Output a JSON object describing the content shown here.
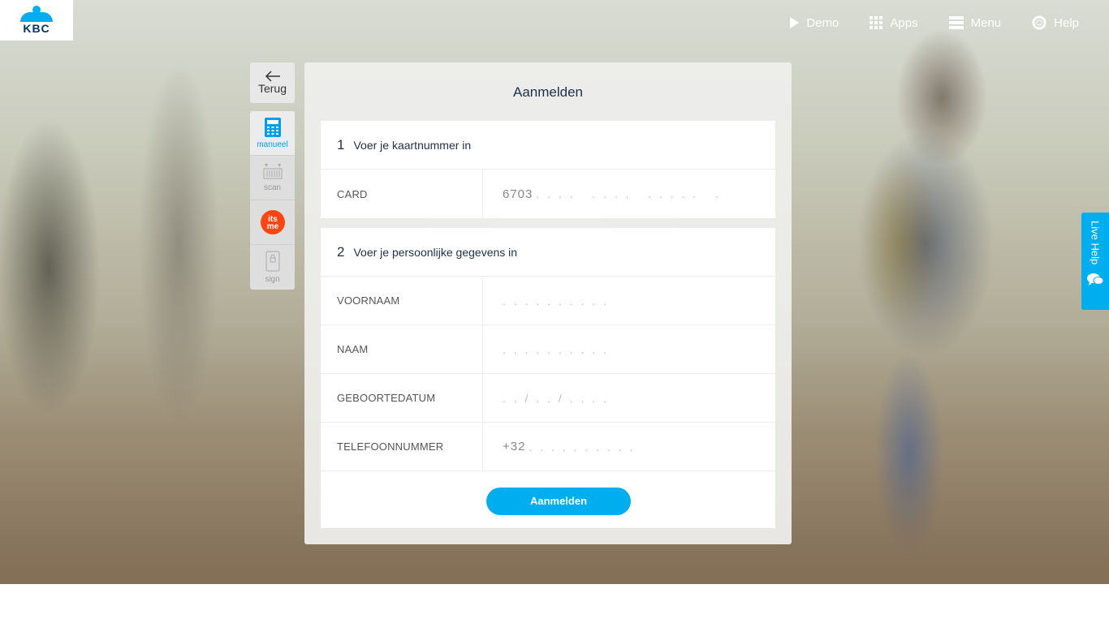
{
  "brand": {
    "logo_text": "KBC",
    "accent": "#00aeef",
    "navy": "#1e2f4a"
  },
  "topnav": [
    {
      "label": "Demo",
      "icon": "play-icon"
    },
    {
      "label": "Apps",
      "icon": "grid-icon"
    },
    {
      "label": "Menu",
      "icon": "menu-icon"
    },
    {
      "label": "Help",
      "icon": "lifebuoy-icon"
    }
  ],
  "sidebar": {
    "back_label": "Terug",
    "methods": [
      {
        "label": "manueel",
        "icon": "calculator-icon",
        "active": true
      },
      {
        "label": "scan",
        "icon": "card-reader-icon",
        "active": false
      },
      {
        "label": "itsme",
        "icon": "itsme-icon",
        "active": false
      },
      {
        "label": "sign",
        "icon": "sign-device-icon",
        "active": false
      }
    ]
  },
  "panel": {
    "title": "Aanmelden",
    "step1": {
      "number": "1",
      "label": "Voer je kaartnummer in",
      "card_label": "CARD",
      "card_prefix": "6703",
      "card_placeholder": ". . . .   . . . .   . . . . .   ."
    },
    "step2": {
      "number": "2",
      "label": "Voer je persoonlijke gegevens in",
      "fields": [
        {
          "label": "VOORNAAM",
          "prefix": "",
          "placeholder": ". . . . . . . . . ."
        },
        {
          "label": "NAAM",
          "prefix": "",
          "placeholder": ". . . . . . . . . ."
        },
        {
          "label": "GEBOORTEDATUM",
          "prefix": "",
          "placeholder": ". . / . . / . . . ."
        },
        {
          "label": "TELEFOONNUMMER",
          "prefix": "+32",
          "placeholder": ". . . . . . . . . ."
        }
      ]
    },
    "submit_label": "Aanmelden"
  },
  "live_help": {
    "label": "Live Help",
    "icon": "chat-icon"
  }
}
